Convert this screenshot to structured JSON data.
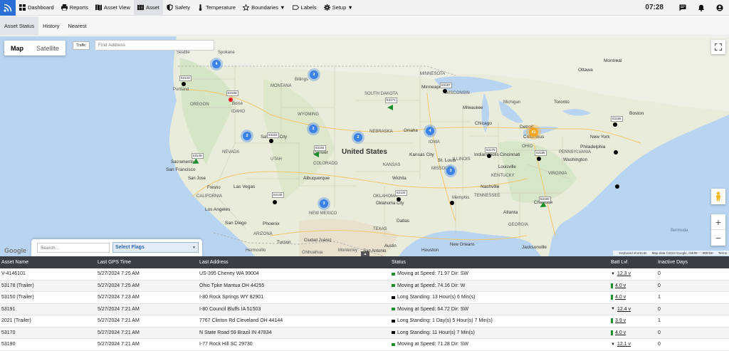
{
  "topbar": {
    "items": [
      {
        "label": "Dashboard",
        "icon": "dashboard-icon"
      },
      {
        "label": "Reports",
        "icon": "printer-icon"
      },
      {
        "label": "Asset View",
        "icon": "map-icon"
      },
      {
        "label": "Asset",
        "icon": "asset-icon",
        "active": true
      },
      {
        "label": "Safety",
        "icon": "shield-icon"
      },
      {
        "label": "Temperature",
        "icon": "thermometer-icon"
      },
      {
        "label": "Boundaries ▼",
        "icon": "star-icon"
      },
      {
        "label": "Labels",
        "icon": "tag-icon"
      },
      {
        "label": "Setup ▼",
        "icon": "gear-icon"
      }
    ],
    "clock": "07:28"
  },
  "subtabs": [
    "Asset Status",
    "History",
    "Nearest"
  ],
  "map": {
    "type_map": "Map",
    "type_satellite": "Satellite",
    "traffic": "Traffic",
    "address_placeholder": "Find Address",
    "country_label": "United States",
    "google": "Google",
    "attribution": {
      "shortcuts": "Keyboard shortcuts",
      "data": "Map data ©2024 Google, INEGI",
      "scale": "200 km",
      "terms": "Terms"
    },
    "clusters": [
      "4",
      "2",
      "2",
      "2",
      "2",
      "4",
      "3",
      "3",
      "41"
    ],
    "units": [
      "53133",
      "53159",
      "53187",
      "53173",
      "53153",
      "53149",
      "53184",
      "53179",
      "53185",
      "53156",
      "53138",
      "53134",
      "53190"
    ],
    "places": [
      "Seattle",
      "Spokane",
      "Billings",
      "Portland",
      "OREGON",
      "IDAHO",
      "Boise",
      "MONTANA",
      "WYOMING",
      "NEVADA",
      "UTAH",
      "Salt Lake City",
      "Sacramento",
      "San Francisco",
      "San Jose",
      "Fresno",
      "CALIFORNIA",
      "Las Vegas",
      "Los Angeles",
      "San Diego",
      "Phoenix",
      "ARIZONA",
      "Tucson",
      "Albuquerque",
      "NEW MEXICO",
      "Ciudad Juárez",
      "Denver",
      "COLORADO",
      "NEBRASKA",
      "Omaha",
      "KANSAS",
      "Kansas City",
      "Wichita",
      "OKLAHOMA",
      "Oklahoma City",
      "TEXAS",
      "Dallas",
      "Austin",
      "San Antonio",
      "Houston",
      "SOUTH DAKOTA",
      "MINNESOTA",
      "Minneapolis",
      "WISCONSIN",
      "IOWA",
      "Chicago",
      "Detroit",
      "Milwaukee",
      "ILLINOIS",
      "St. Louis",
      "MISSOURI",
      "Indianapolis",
      "Cincinnati",
      "OHIO",
      "Columbus",
      "Toronto",
      "Ottawa",
      "Montreal",
      "New York",
      "Philadelphia",
      "Washington",
      "Boston",
      "Nashville",
      "Memphis",
      "TENNESSEE",
      "Atlanta",
      "GEORGIA",
      "Charlotte",
      "Louisville",
      "KENTUCKY",
      "Jacksonville",
      "New Orleans",
      "Bermuda",
      "Chihuahua",
      "Monterrey",
      "Hermosillo",
      "Michigan",
      "PENNSYLVANIA",
      "VIRGINIA"
    ]
  },
  "filters": {
    "search_placeholder": "Search...",
    "flags_label": "Select Flags"
  },
  "table": {
    "headers": [
      "Asset Name",
      "Last GPS Time",
      "Last Address",
      "Status",
      "Batt Lvl",
      "Inactive Days"
    ],
    "rows": [
      {
        "name": "V-4146101",
        "time": "5/27/2024 7:25 AM",
        "address": "US-395 Cheney WA 99004",
        "status": "Moving at Speed: 71.97 Dir: SW",
        "status_color": "#1c8f2c",
        "batt": "12.3 v",
        "batt_type": "plug",
        "inactive": "0"
      },
      {
        "name": "53178 (Trailer)",
        "time": "5/27/2024 7:25 AM",
        "address": "Ohio Tpke Mantua OH 44255",
        "status": "Moving at Speed: 74.16 Dir: W",
        "status_color": "#1c8f2c",
        "batt": "4.0 v",
        "batt_type": "battery",
        "inactive": "0"
      },
      {
        "name": "53150 (Trailer)",
        "time": "5/27/2024 7:23 AM",
        "address": "I-80 Rock Springs WY 82901",
        "status": "Long Standing: 13 Hour(s) 6 Min(s)",
        "status_color": "#000000",
        "batt": "4.0 v",
        "batt_type": "battery",
        "inactive": "1"
      },
      {
        "name": "53191",
        "time": "5/27/2024 7:21 AM",
        "address": "I-80 Council Bluffs IA 51503",
        "status": "Moving at Speed: 64.72 Dir: SW",
        "status_color": "#1c8f2c",
        "batt": "12.4 v",
        "batt_type": "plug",
        "inactive": "0"
      },
      {
        "name": "2021 (Trailer)",
        "time": "5/27/2024 7:21 AM",
        "address": "7767 Clinton Rd Cleveland OH 44144",
        "status": "Long Standing: 1 Day(s) 5 Hour(s) 7 Min(s)",
        "status_color": "#000000",
        "batt": "3.9 v",
        "batt_type": "battery",
        "inactive": "1"
      },
      {
        "name": "53170",
        "time": "5/27/2024 7:21 AM",
        "address": "N State Road 59 Brazil IN 47834",
        "status": "Long Standing: 11 Hour(s) 7 Min(s)",
        "status_color": "#000000",
        "batt": "4.0 v",
        "batt_type": "battery",
        "inactive": "0"
      },
      {
        "name": "53190",
        "time": "5/27/2024 7:21 AM",
        "address": "I-77 Rock Hill SC 29730",
        "status": "Moving at Speed: 71.28 Dir: SW",
        "status_color": "#1c8f2c",
        "batt": "12.1 v",
        "batt_type": "plug",
        "inactive": "0"
      }
    ]
  },
  "colors": {
    "accent": "#2b6fd6",
    "moving": "#1c8f2c",
    "standing": "#000000",
    "cluster": "#3b82e8",
    "cluster_large": "#f5a623",
    "table_header": "#3a3d41"
  }
}
